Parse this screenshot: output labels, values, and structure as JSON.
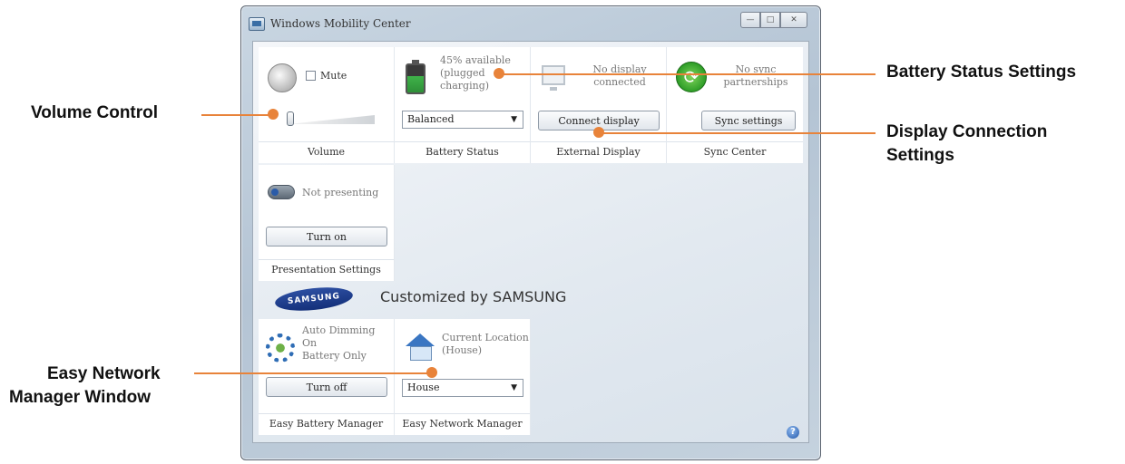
{
  "window": {
    "title": "Windows Mobility Center",
    "caption_min": "—",
    "caption_max": "□",
    "caption_close": "✕"
  },
  "tiles": {
    "volume": {
      "mute_label": "Mute",
      "label": "Volume"
    },
    "battery": {
      "status_line1": "45% available",
      "status_line2": "(plugged",
      "status_line3": "charging)",
      "select_value": "Balanced",
      "label": "Battery Status",
      "charge_percent": 45
    },
    "display": {
      "status_line1": "No display",
      "status_line2": "connected",
      "button": "Connect display",
      "label": "External Display"
    },
    "sync": {
      "status_line1": "No sync",
      "status_line2": "partnerships",
      "button": "Sync settings",
      "label": "Sync Center"
    },
    "presentation": {
      "status": "Not presenting",
      "button": "Turn on",
      "label": "Presentation Settings"
    },
    "easy_battery": {
      "status_line1": "Auto Dimming",
      "status_line2": "On",
      "status_line3": "Battery Only",
      "button": "Turn off",
      "label": "Easy Battery Manager"
    },
    "easy_network": {
      "status_line1": "Current Location",
      "status_line2": "(House)",
      "select_value": "House",
      "label": "Easy Network Manager"
    }
  },
  "samsung": {
    "logo_text": "SAMSUNG",
    "heading": "Customized by SAMSUNG"
  },
  "callouts": {
    "volume": "Volume Control",
    "battery": "Battery Status Settings",
    "display_line1": "Display Connection",
    "display_line2": "Settings",
    "network_line1": "Easy Network",
    "network_line2": "Manager Window"
  },
  "colors": {
    "accent": "#e8833a",
    "samsung_blue": "#1e3d8f"
  },
  "icons": [
    "speaker-icon",
    "battery-icon",
    "monitor-icon",
    "sync-icon",
    "projector-icon",
    "gear-icon",
    "house-icon",
    "help-icon"
  ]
}
